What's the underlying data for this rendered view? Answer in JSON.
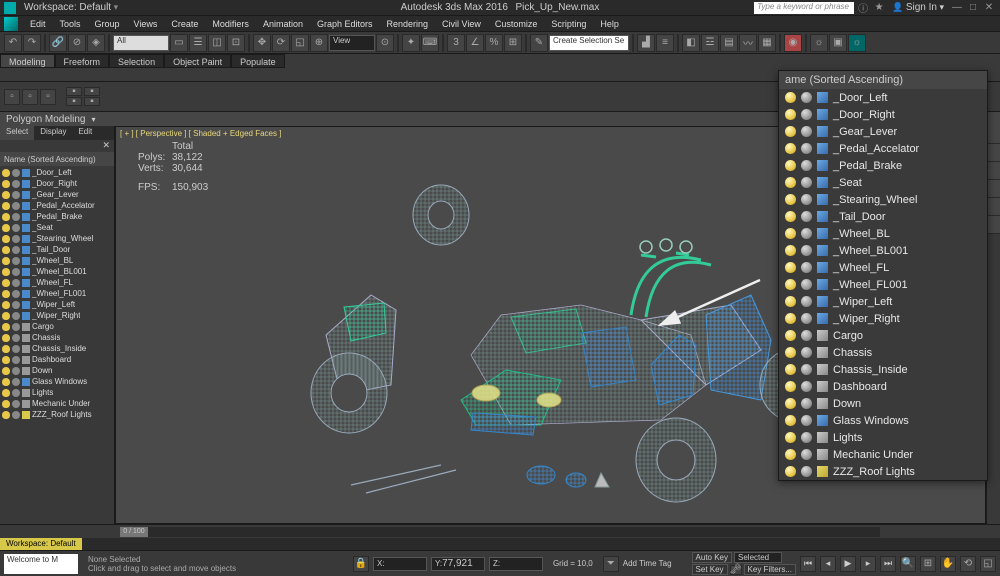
{
  "title": {
    "app": "Autodesk 3ds Max 2016",
    "file": "Pick_Up_New.max",
    "search_placeholder": "Type a keyword or phrase",
    "signin": "Sign In"
  },
  "workspace_label": "Workspace: Default",
  "menu": [
    "Edit",
    "Tools",
    "Group",
    "Views",
    "Create",
    "Modifiers",
    "Animation",
    "Graph Editors",
    "Rendering",
    "Civil View",
    "Customize",
    "Scripting",
    "Help"
  ],
  "toolbar": {
    "select_filter": "All",
    "dropdown_mid": "View",
    "create_sel": "Create Selection Se"
  },
  "ribbon_tabs": [
    "Modeling",
    "Freeform",
    "Selection",
    "Object Paint",
    "Populate"
  ],
  "poly_modeling": "Polygon Modeling",
  "scene_tabs": [
    "Select",
    "Display",
    "Edit"
  ],
  "scene_header": "Name (Sorted Ascending)",
  "scene_items": [
    {
      "name": "_Door_Left",
      "ic": "blue"
    },
    {
      "name": "_Door_Right",
      "ic": "blue"
    },
    {
      "name": "_Gear_Lever",
      "ic": "blue"
    },
    {
      "name": "_Pedal_Accelator",
      "ic": "blue"
    },
    {
      "name": "_Pedal_Brake",
      "ic": "blue"
    },
    {
      "name": "_Seat",
      "ic": "blue"
    },
    {
      "name": "_Stearing_Wheel",
      "ic": "blue"
    },
    {
      "name": "_Tail_Door",
      "ic": "blue"
    },
    {
      "name": "_Wheel_BL",
      "ic": "blue"
    },
    {
      "name": "_Wheel_BL001",
      "ic": "blue"
    },
    {
      "name": "_Wheel_FL",
      "ic": "blue"
    },
    {
      "name": "_Wheel_FL001",
      "ic": "blue"
    },
    {
      "name": "_Wiper_Left",
      "ic": "blue"
    },
    {
      "name": "_Wiper_Right",
      "ic": "blue"
    },
    {
      "name": "Cargo",
      "ic": "gray"
    },
    {
      "name": "Chassis",
      "ic": "gray"
    },
    {
      "name": "Chassis_Inside",
      "ic": "gray"
    },
    {
      "name": "Dashboard",
      "ic": "gray"
    },
    {
      "name": "Down",
      "ic": "gray"
    },
    {
      "name": "Glass Windows",
      "ic": "blue"
    },
    {
      "name": "Lights",
      "ic": "gray"
    },
    {
      "name": "Mechanic Under",
      "ic": "gray"
    },
    {
      "name": "ZZZ_Roof Lights",
      "ic": "yellow"
    }
  ],
  "viewport": {
    "label": "[ + ] [ Perspective ] [ Shaded + Edged Faces ]",
    "stats_header": "Total",
    "polys": "38,122",
    "verts": "30,644",
    "fps": "150,903"
  },
  "timeline": {
    "range": "0 / 100",
    "thumb": "0 / 100"
  },
  "workspace_bar": "Workspace: Default",
  "status": {
    "left": "Welcome to M",
    "none_selected": "None Selected",
    "hint": "Click and drag to select and move objects",
    "x": "",
    "y": "77,921",
    "z": "",
    "grid": "Grid = 10,0",
    "add_time_tag": "Add Time Tag",
    "autokey": "Auto Key",
    "setkey": "Set Key",
    "selected": "Selected",
    "keyfilters": "Key Filters..."
  },
  "enlarged_header": "ame (Sorted Ascending)"
}
